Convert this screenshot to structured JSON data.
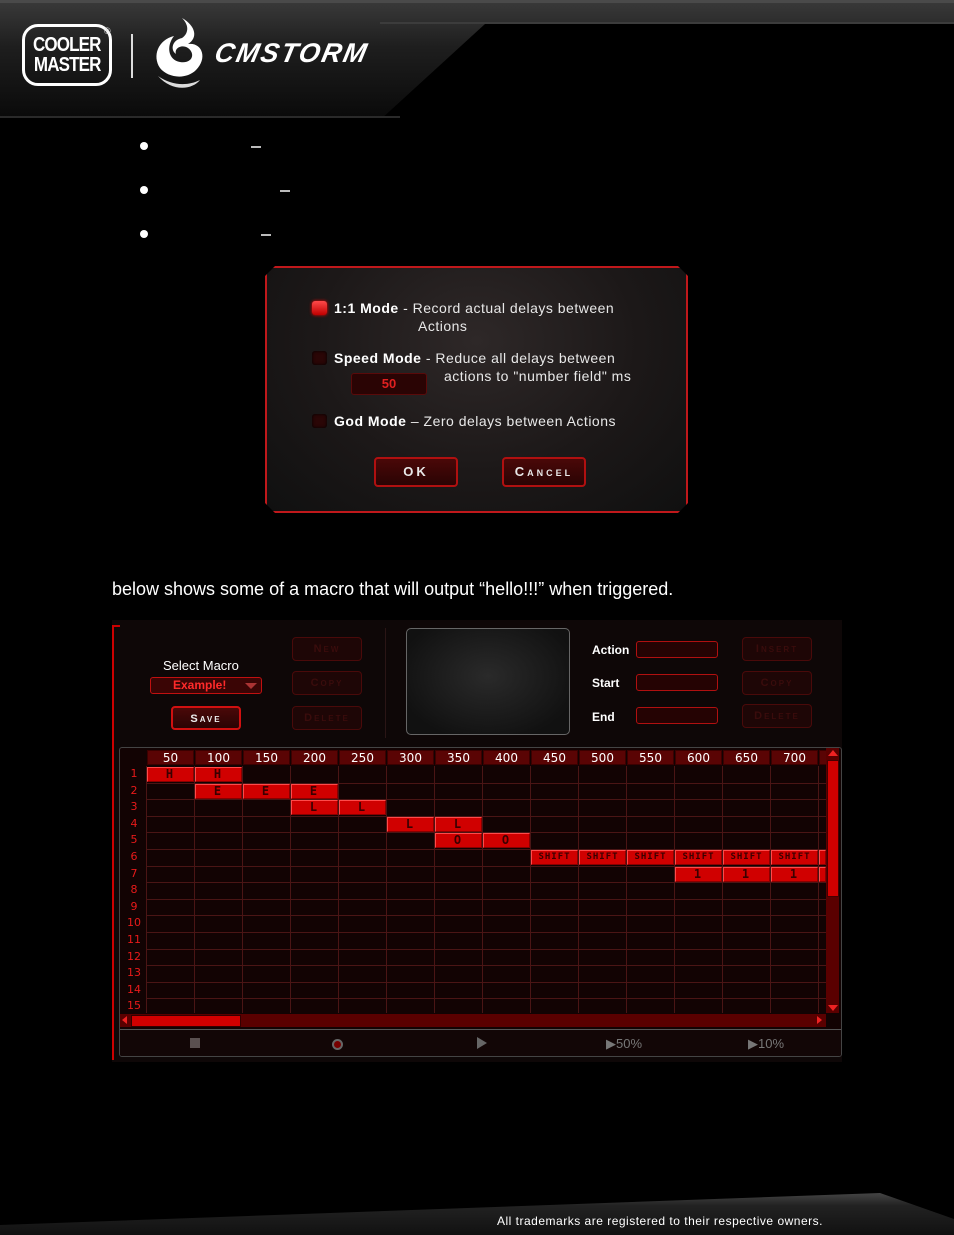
{
  "header": {
    "brand_left_line1": "COOLER",
    "brand_left_line2": "MASTER",
    "registered_mark": "®",
    "brand_right": "CMSTORM",
    "logo_icon": "cmstorm-swirl-icon"
  },
  "bullets": [
    {
      "text": "",
      "dash": "–"
    },
    {
      "text": "",
      "dash": "–"
    },
    {
      "text": "",
      "dash": "–"
    }
  ],
  "dialog": {
    "modes": [
      {
        "title": "1:1 Mode",
        "separator": " - ",
        "desc_line1": "Record actual delays between",
        "desc_line2": "Actions",
        "checked": true
      },
      {
        "title": "Speed Mode",
        "separator": " - ",
        "desc_line1": "Reduce all delays between",
        "desc_line2": "actions to \"number field\" ms",
        "checked": false
      },
      {
        "title": "God Mode",
        "separator": " – ",
        "desc_line1": "Zero delays between Actions",
        "checked": false
      }
    ],
    "speed_value": "50",
    "ok_label": "OK",
    "cancel_label": "Cancel"
  },
  "paragraph": "below shows some of a macro that will output “hello!!!” when triggered.",
  "macro_editor": {
    "select_label": "Select Macro",
    "selected_macro": "Example!",
    "save_label": "Save",
    "new_label": "New",
    "copy_label": "Copy",
    "delete_label": "Delete",
    "action_label": "Action",
    "start_label": "Start",
    "end_label": "End",
    "action_value": "",
    "start_value": "",
    "end_value": "",
    "insert_label": "Insert",
    "copy2_label": "Copy",
    "delete2_label": "Delete",
    "columns": [
      "50",
      "100",
      "150",
      "200",
      "250",
      "300",
      "350",
      "400",
      "450",
      "500",
      "550",
      "600",
      "650",
      "700"
    ],
    "rows": [
      "1",
      "2",
      "3",
      "4",
      "5",
      "6",
      "7",
      "8",
      "9",
      "10",
      "11",
      "12",
      "13",
      "14",
      "15"
    ],
    "events": [
      {
        "row": 1,
        "key": "H",
        "cols": [
          0,
          1
        ]
      },
      {
        "row": 2,
        "key": "E",
        "cols": [
          1,
          2,
          3
        ]
      },
      {
        "row": 3,
        "key": "L",
        "cols": [
          3,
          4
        ]
      },
      {
        "row": 4,
        "key": "L",
        "cols": [
          5,
          6
        ]
      },
      {
        "row": 5,
        "key": "O",
        "cols": [
          6,
          7
        ]
      },
      {
        "row": 6,
        "key": "SHIFT",
        "cols": [
          8,
          9,
          10,
          11,
          12,
          13,
          14
        ]
      },
      {
        "row": 7,
        "key": "1",
        "cols": [
          11,
          12,
          13,
          14
        ]
      }
    ],
    "controls": {
      "stop_icon": "stop-icon",
      "record_icon": "record-icon",
      "play_icon": "play-icon",
      "speed1_label": "50%",
      "speed2_label": "10%"
    }
  },
  "footer": {
    "text": "All trademarks are registered to their respective owners."
  }
}
